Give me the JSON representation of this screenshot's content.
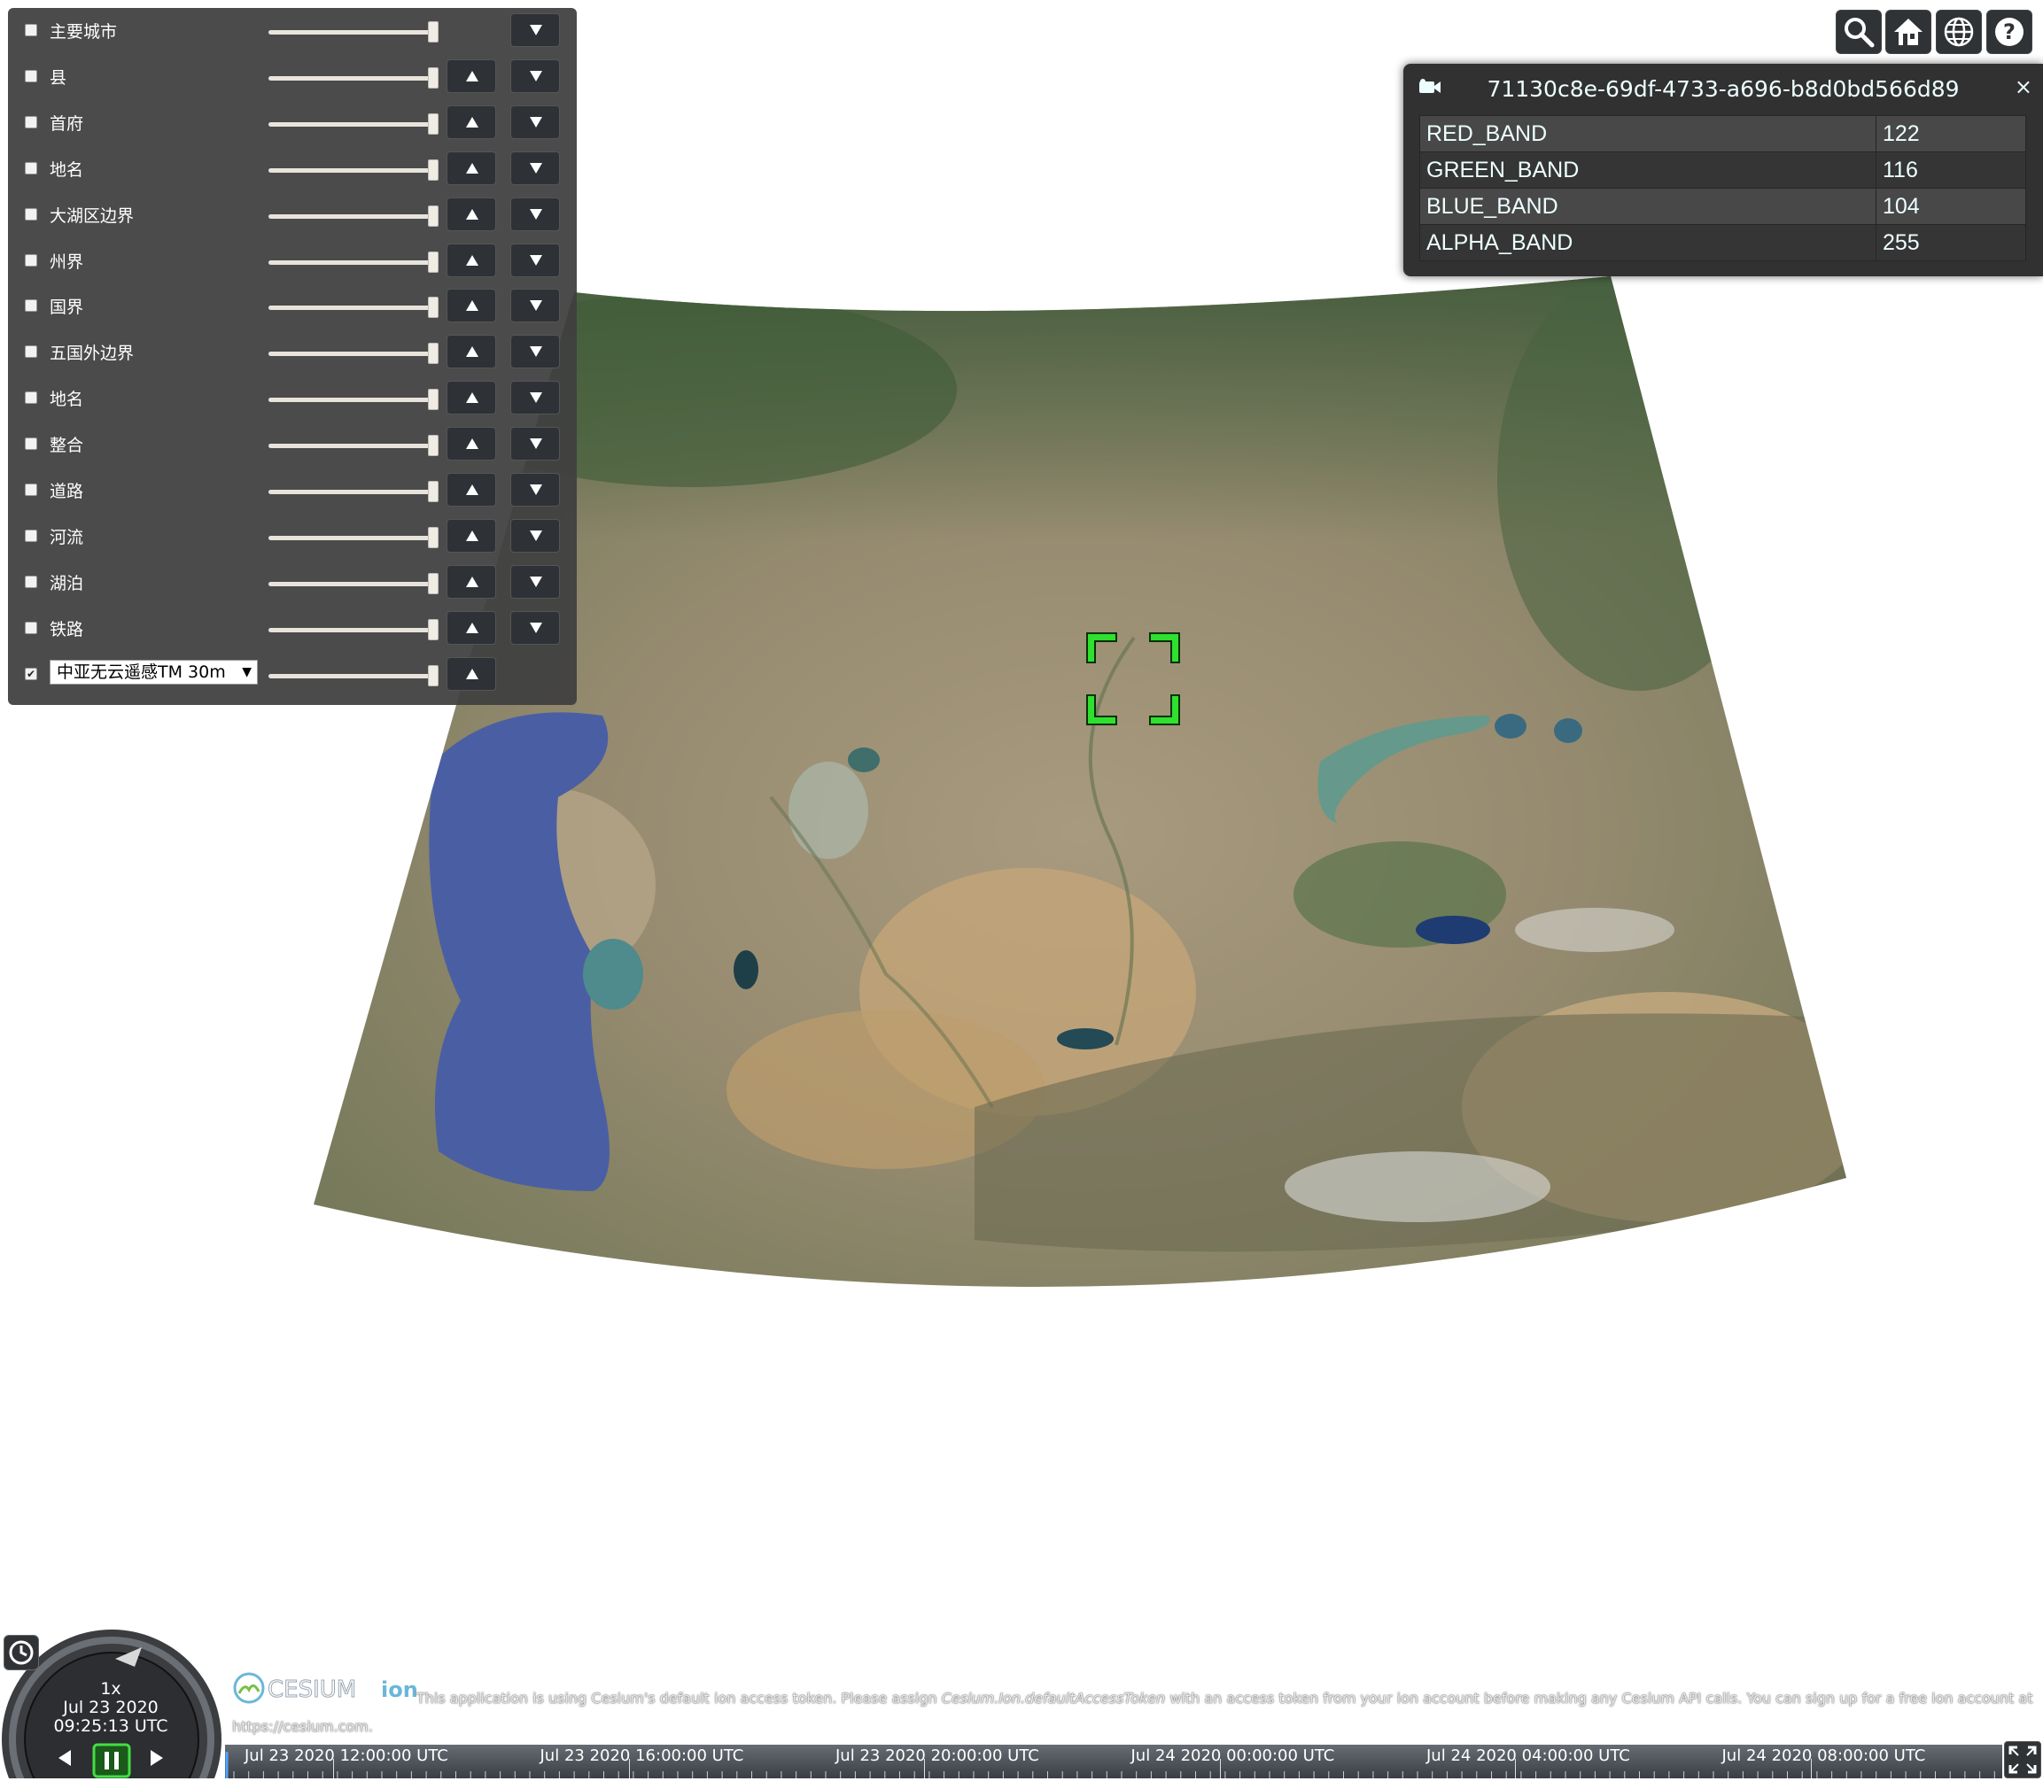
{
  "layers": [
    {
      "name": "主要城市",
      "checked": false,
      "show_up": false,
      "show_down": true
    },
    {
      "name": "县",
      "checked": false,
      "show_up": true,
      "show_down": true
    },
    {
      "name": "首府",
      "checked": false,
      "show_up": true,
      "show_down": true
    },
    {
      "name": "地名",
      "checked": false,
      "show_up": true,
      "show_down": true
    },
    {
      "name": "大湖区边界",
      "checked": false,
      "show_up": true,
      "show_down": true
    },
    {
      "name": "州界",
      "checked": false,
      "show_up": true,
      "show_down": true
    },
    {
      "name": "国界",
      "checked": false,
      "show_up": true,
      "show_down": true
    },
    {
      "name": "五国外边界",
      "checked": false,
      "show_up": true,
      "show_down": true
    },
    {
      "name": "地名",
      "checked": false,
      "show_up": true,
      "show_down": true
    },
    {
      "name": "整合",
      "checked": false,
      "show_up": true,
      "show_down": true
    },
    {
      "name": "道路",
      "checked": false,
      "show_up": true,
      "show_down": true
    },
    {
      "name": "河流",
      "checked": false,
      "show_up": true,
      "show_down": true
    },
    {
      "name": "湖泊",
      "checked": false,
      "show_up": true,
      "show_down": true
    },
    {
      "name": "铁路",
      "checked": false,
      "show_up": true,
      "show_down": true
    },
    {
      "name": "中亚无云遥感TM 30m",
      "checked": true,
      "show_up": true,
      "show_down": false,
      "is_select": true
    }
  ],
  "slider_value": 1.0,
  "toolbar": {
    "buttons": [
      {
        "name": "search-button",
        "icon": "search-icon"
      },
      {
        "name": "home-button",
        "icon": "home-icon"
      },
      {
        "name": "scene-mode-button",
        "icon": "globe-icon"
      },
      {
        "name": "help-button",
        "icon": "help-icon"
      }
    ]
  },
  "infobox": {
    "title": "71130c8e-69df-4733-a696-b8d0bd566d89",
    "close": "×",
    "rows": [
      {
        "key": "RED_BAND",
        "value": "122"
      },
      {
        "key": "GREEN_BAND",
        "value": "116"
      },
      {
        "key": "BLUE_BAND",
        "value": "104"
      },
      {
        "key": "ALPHA_BAND",
        "value": "255"
      }
    ]
  },
  "animation": {
    "speed": "1x",
    "date": "Jul 23 2020",
    "time": "09:25:13 UTC"
  },
  "credits": {
    "logo_text": "CESIUM",
    "logo_ion": "ion",
    "message_before": "This application is using Cesium's default ion access token. Please assign ",
    "message_code": "Cesium.Ion.defaultAccessToken",
    "message_after": " with an access token from your ion account before making any Cesium API calls. You can sign up for a free ion account at",
    "link": "https://cesium.com."
  },
  "timeline": {
    "labels": [
      "Jul 23 2020 12:00:00 UTC",
      "Jul 23 2020 16:00:00 UTC",
      "Jul 23 2020 20:00:00 UTC",
      "Jul 24 2020 00:00:00 UTC",
      "Jul 24 2020 04:00:00 UTC",
      "Jul 24 2020 08:00:00 UTC"
    ]
  },
  "colors": {
    "panel_bg": "#404040",
    "button_bg": "#303336",
    "crosshair": "#33dd33",
    "caspian": "#4a5fa3"
  }
}
